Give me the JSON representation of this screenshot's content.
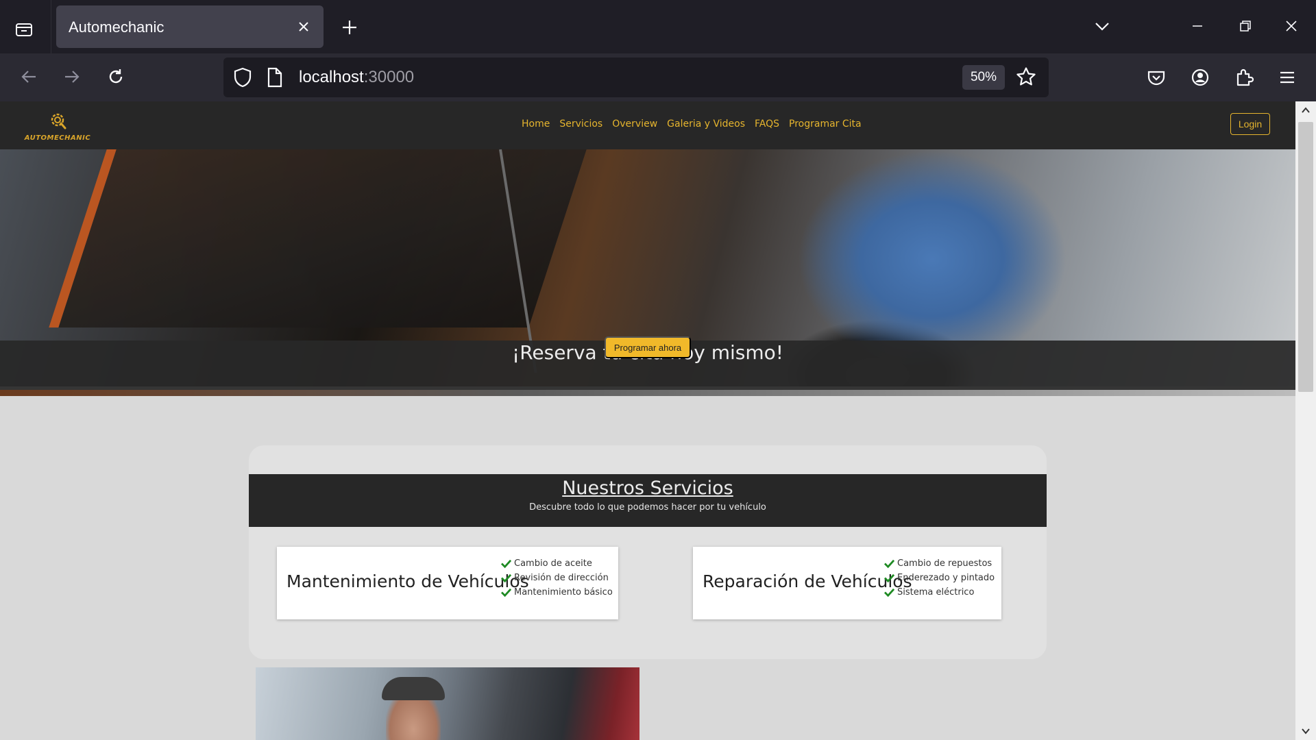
{
  "browser": {
    "tab_title": "Automechanic",
    "url_host": "localhost",
    "url_port": ":30000",
    "zoom": "50%"
  },
  "site": {
    "logo_text": "AUTOMECHANIC",
    "nav": [
      "Home",
      "Servicios",
      "Overview",
      "Galeria y Videos",
      "FAQS",
      "Programar Cita"
    ],
    "login_label": "Login"
  },
  "hero": {
    "title": "¡Reserva tu cita hoy mismo!",
    "button_label": "Programar ahora"
  },
  "services": {
    "title": "Nuestros Servicios",
    "subtitle": "Descubre todo lo que podemos hacer por tu vehículo",
    "cards": [
      {
        "title": "Mantenimiento de Vehículos",
        "items": [
          "Cambio de aceite",
          "Revisión de dirección",
          "Mantenimiento básico"
        ]
      },
      {
        "title": "Reparación de Vehículos",
        "items": [
          "Cambio de repuestos",
          "Enderezado y pintado",
          "Sistema eléctrico"
        ]
      }
    ]
  },
  "colors": {
    "accent": "#e6b52e",
    "button": "#f1b92a",
    "header_bg": "#272727",
    "check": "#1e8a23"
  }
}
